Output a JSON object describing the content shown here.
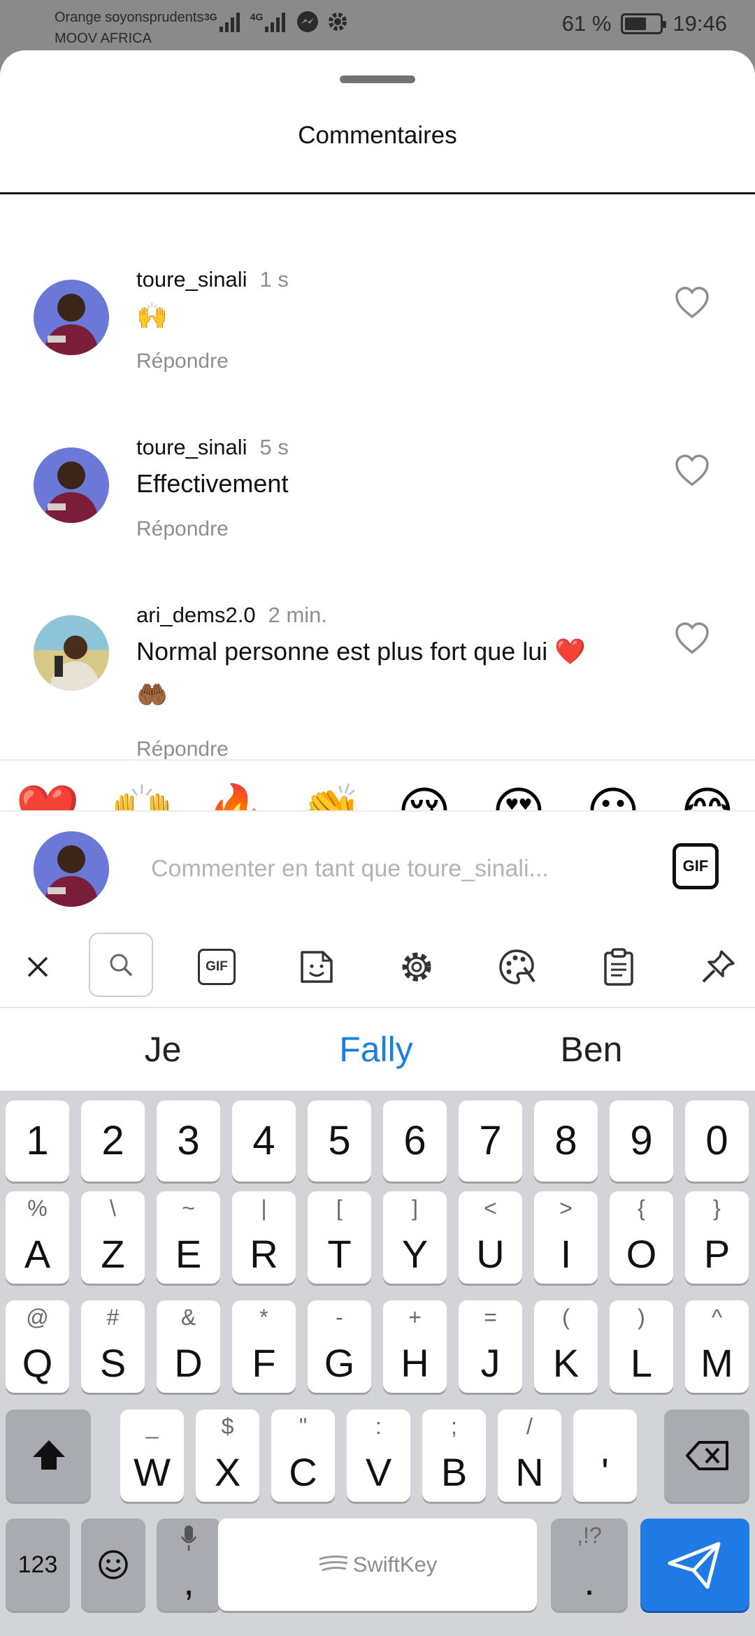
{
  "status_bar": {
    "carrier_line1": "Orange soyonsprudents",
    "carrier_line2": "MOOV AFRICA",
    "net1": "3G",
    "net2": "4G",
    "battery_percent": "61 %",
    "battery_level": 0.61,
    "time": "19:46"
  },
  "sheet": {
    "title": "Commentaires"
  },
  "comments": [
    {
      "username": "toure_sinali",
      "time": "1 s",
      "text": "🙌",
      "reply": "Répondre"
    },
    {
      "username": "toure_sinali",
      "time": "5 s",
      "text": "Effectivement",
      "reply": "Répondre"
    },
    {
      "username": "ari_dems2.0",
      "time": "2 min.",
      "text_line1": "Normal personne est plus fort que lui ❤️",
      "text_line2": "🤲🏾",
      "reply": "Répondre"
    }
  ],
  "emoji_bar": [
    "❤️",
    "🙌",
    "🔥",
    "👏",
    "😢",
    "😍",
    "😮",
    "😂"
  ],
  "input": {
    "placeholder": "Commenter en tant que toure_sinali...",
    "gif_label": "GIF"
  },
  "keyboard": {
    "toolbar": [
      "close-icon",
      "search-icon",
      "gif-icon",
      "sticker-icon",
      "settings-icon",
      "palette-icon",
      "clipboard-icon",
      "pin-icon"
    ],
    "toolbar_gif_label": "GIF",
    "suggestions": [
      "Je",
      "Fally",
      "Ben"
    ],
    "number_row": [
      "1",
      "2",
      "3",
      "4",
      "5",
      "6",
      "7",
      "8",
      "9",
      "0"
    ],
    "row1": [
      [
        "A",
        "%"
      ],
      [
        "Z",
        "\\"
      ],
      [
        "E",
        "~"
      ],
      [
        "R",
        "|"
      ],
      [
        "T",
        "["
      ],
      [
        "Y",
        "]"
      ],
      [
        "U",
        "<"
      ],
      [
        "I",
        ">"
      ],
      [
        "O",
        "{"
      ],
      [
        "P",
        "}"
      ]
    ],
    "row2": [
      [
        "Q",
        "@"
      ],
      [
        "S",
        "#"
      ],
      [
        "D",
        "&"
      ],
      [
        "F",
        "*"
      ],
      [
        "G",
        "-"
      ],
      [
        "H",
        "+"
      ],
      [
        "J",
        "="
      ],
      [
        "K",
        "("
      ],
      [
        "L",
        ")"
      ],
      [
        "M",
        "^"
      ]
    ],
    "row3": [
      [
        "W",
        "_"
      ],
      [
        "X",
        "$"
      ],
      [
        "C",
        "\""
      ],
      [
        "V",
        ":"
      ],
      [
        "B",
        ";"
      ],
      [
        "N",
        "/"
      ],
      [
        "'",
        ""
      ]
    ],
    "numbers_key": "123",
    "comma_key": ",",
    "space_label": "SwiftKey",
    "period_key": ".",
    "period_sub": ",!?"
  },
  "colors": {
    "accent": "#1f7be3",
    "suggestion_active": "#1c7fe0",
    "heart_emoji": "#e0245e"
  }
}
